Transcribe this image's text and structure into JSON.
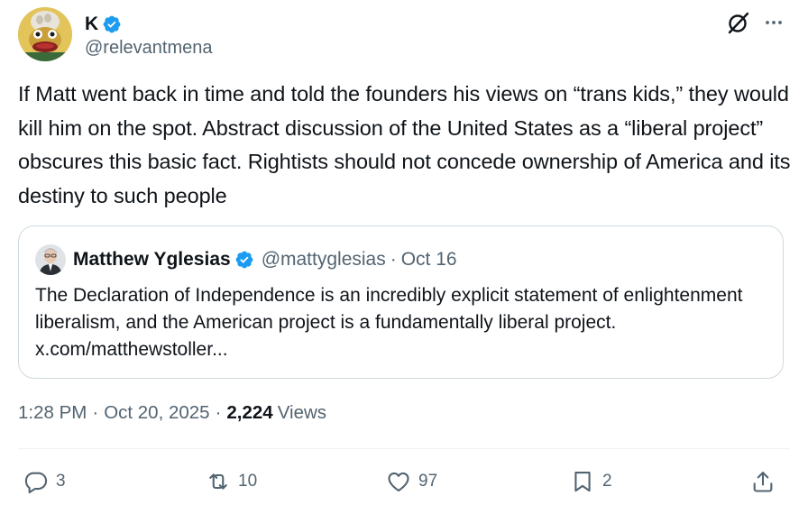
{
  "author": {
    "name": "K",
    "handle": "@relevantmena"
  },
  "tweet": {
    "text": "If Matt went back in time and told the founders his views on “trans kids,” they would kill him on the spot. Abstract discussion of the United States as a “liberal project” obscures this basic fact. Rightists should not concede ownership of America and its destiny to such people"
  },
  "quote": {
    "name": "Matthew Yglesias",
    "handle": "@mattyglesias",
    "separator": "·",
    "date": "Oct 16",
    "text": "The Declaration of Independence is an incredibly explicit statement of enlightenment liberalism, and the American project is a fundamentally liberal project. x.com/matthewstoller..."
  },
  "meta": {
    "time": "1:28 PM",
    "dot1": "·",
    "date": "Oct 20, 2025",
    "dot2": "·",
    "views_count": "2,224",
    "views_label": "Views"
  },
  "actions": {
    "replies": "3",
    "reposts": "10",
    "likes": "97",
    "bookmarks": "2"
  },
  "colors": {
    "text": "#0f1419",
    "secondary": "#536471",
    "verified": "#1d9bf0",
    "border": "#cfd9de"
  },
  "icons": [
    "verified-badge-icon",
    "grok-icon",
    "more-icon",
    "reply-icon",
    "repost-icon",
    "like-icon",
    "bookmark-icon",
    "share-icon"
  ]
}
